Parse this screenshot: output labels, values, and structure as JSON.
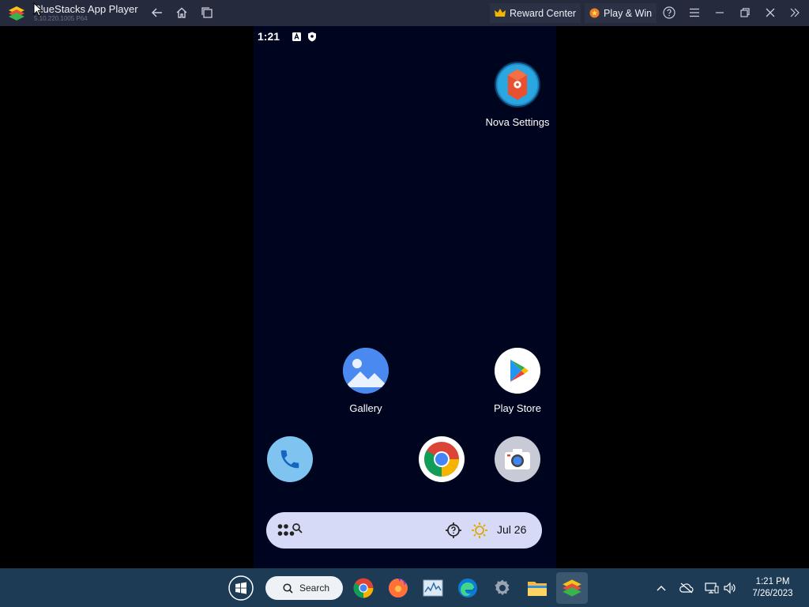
{
  "window": {
    "title": "BlueStacks App Player",
    "version": "5.10.220.1005 P64"
  },
  "toolbar": {
    "reward_center": "Reward Center",
    "play_win": "Play & Win"
  },
  "android": {
    "status_time": "1:21",
    "apps": {
      "nova_settings": "Nova Settings",
      "gallery": "Gallery",
      "play_store": "Play Store"
    },
    "dock": [
      "phone",
      "chrome",
      "camera"
    ],
    "widget": {
      "date": "Jul 26"
    }
  },
  "taskbar": {
    "search_label": "Search",
    "time": "1:21 PM",
    "date": "7/26/2023"
  },
  "colors": {
    "titlebar": "#252a3c",
    "android_bg": "#00051f",
    "taskbar": "#1d3b55",
    "widget": "#d6daf7"
  }
}
